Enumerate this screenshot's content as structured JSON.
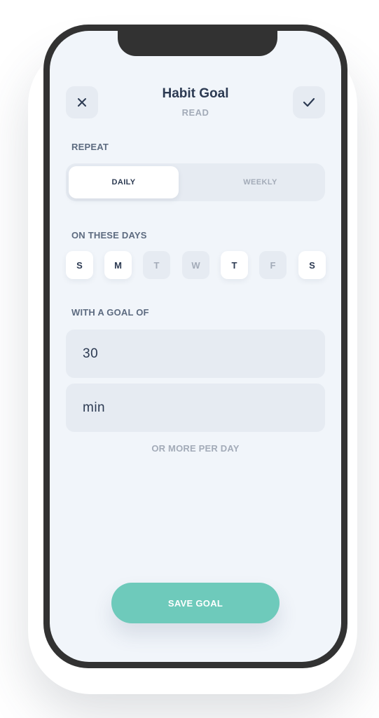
{
  "header": {
    "title": "Habit Goal",
    "subtitle": "READ",
    "close_icon": "close-icon",
    "confirm_icon": "checkmark-icon"
  },
  "repeat": {
    "label": "REPEAT",
    "options": [
      "DAILY",
      "WEEKLY"
    ],
    "selected": "DAILY"
  },
  "days": {
    "label": "ON THESE DAYS",
    "items": [
      {
        "letter": "S",
        "selected": true
      },
      {
        "letter": "M",
        "selected": true
      },
      {
        "letter": "T",
        "selected": false
      },
      {
        "letter": "W",
        "selected": false
      },
      {
        "letter": "T",
        "selected": true
      },
      {
        "letter": "F",
        "selected": false
      },
      {
        "letter": "S",
        "selected": true
      }
    ]
  },
  "goal": {
    "label": "WITH A GOAL OF",
    "amount": "30",
    "unit": "min",
    "hint": "OR MORE PER DAY"
  },
  "save_button": {
    "label": "SAVE GOAL"
  },
  "colors": {
    "accent": "#6ecabb",
    "background": "#f1f5fa",
    "chip_inactive": "#e6ebf2",
    "text_primary": "#2c3a52",
    "text_muted": "#a3abb8"
  }
}
